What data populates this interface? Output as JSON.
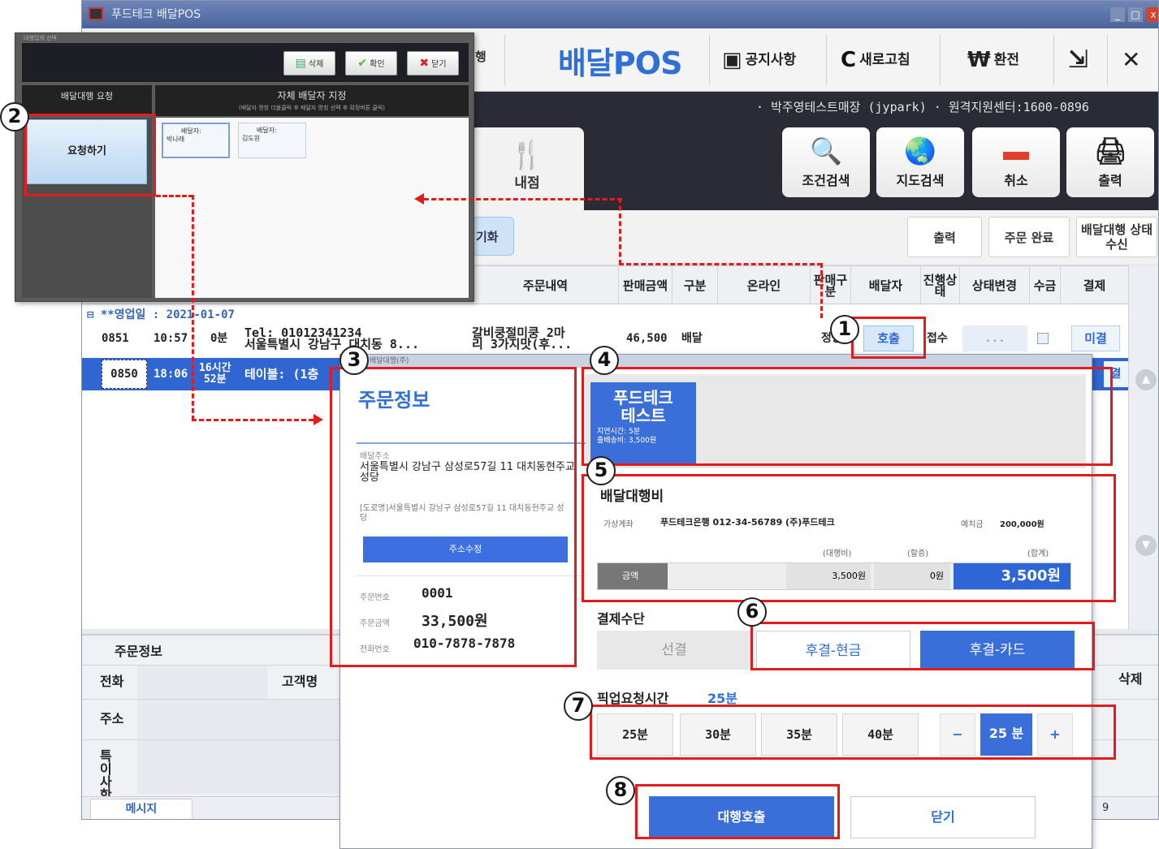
{
  "window": {
    "title": "푸드테크 배달POS"
  },
  "topbar": {
    "tail_fragment": "행",
    "brand_prefix": "배달",
    "brand_suffix": "POS",
    "notice": "공지사항",
    "refresh": "새로고침",
    "exchange": "환전"
  },
  "blackbar": {
    "store_info": "· 박주영테스트매장 (jypark)  · 원격지원센터:1600-0896",
    "store_tab": "내점",
    "buttons": [
      "조건검색",
      "지도검색",
      "취소",
      "출력"
    ]
  },
  "actionbar": {
    "light_fragment": "기화",
    "print": "출력",
    "complete": "주문 완료",
    "agency_status": "배달대행 상태 수신"
  },
  "grid": {
    "headers": [
      "주문내역",
      "판매금액",
      "구분",
      "온라인",
      "판매구분",
      "배달자",
      "진행상태",
      "상태변경",
      "수금",
      "결제"
    ],
    "group": "⊟ **영업일 : 2021-01-07",
    "rows": [
      {
        "no": "0851",
        "time": "10:57",
        "elapsed": "0분",
        "info1": "Tel: 01012341234",
        "info2": "서울특별시 강남구 대치동 8...",
        "items1": "갈비쿵절미쿵 2마",
        "items2": "리 3가지맛(후...",
        "amount": "46,500",
        "type": "배달",
        "sale": "정상",
        "rider": "호출",
        "status": "접수",
        "change": "...",
        "pay": "미결"
      },
      {
        "no": "0850",
        "time": "18:06",
        "elapsed1": "16시간",
        "elapsed2": "52분",
        "info": "테이블: (1층",
        "pay": "결"
      }
    ]
  },
  "bottom": {
    "title": "주문정보",
    "phone": "전화",
    "customer": "고객명",
    "address": "주소",
    "notes": "특이 사항",
    "delete": "삭제",
    "message": "메시지",
    "status_tail": "9"
  },
  "agency_popup": {
    "caption": "대행업체 선택",
    "buttons": [
      "삭제",
      "확인",
      "닫기"
    ],
    "left_head": "배달대행 요청",
    "right_head": "자체 배달자 지정",
    "right_sub": "(배달자 명칭 더블클릭 후 배달자 명칭 선택 후 확정버튼 클릭)",
    "request": "요청하기",
    "riders": [
      {
        "l1": "배달자:",
        "l2": "박나래"
      },
      {
        "l1": "배달자:",
        "l2": "김도원"
      }
    ]
  },
  "order_dialog": {
    "caption": "배달대행(주)",
    "title": "주문정보",
    "addr_label": "배달주소",
    "addr_main": "서울특별시 강남구 삼성로57길 11 대치동현주교 성당",
    "addr_road": "[도로명]서울특별시 강남구 삼성로57길 11 대치동현주교 성당",
    "addr_fix": "주소수정",
    "order_no_label": "주문번호",
    "order_no": "0001",
    "amount_label": "주문금액",
    "amount": "33,500원",
    "phone_label": "전화번호",
    "phone": "010-7878-7878",
    "agency": {
      "name1": "푸드테크",
      "name2": "테스트",
      "delay": "지연시간: 5분",
      "fee": "출배송비: 3,500원"
    },
    "fee_title": "배달대행비",
    "account_label": "가상계좌",
    "account": "푸드테크은행 012-34-56789 (주)푸드테크",
    "prepay_label": "예치금",
    "prepay": "200,000원",
    "col_agency": "(대행비)",
    "col_extra": "(할증)",
    "col_total": "(합계)",
    "amount_row": "금액",
    "agency_fee": "3,500원",
    "extra_fee": "0원",
    "total_fee": "3,500원",
    "pay_label": "결제수단",
    "pay_options": [
      "선결",
      "후결-현금",
      "후결-카드"
    ],
    "pickup_label": "픽업요청시간",
    "pickup_value": "25분",
    "time_options": [
      "25분",
      "30분",
      "35분",
      "40분"
    ],
    "stepper": {
      "minus": "−",
      "value": "25 분",
      "plus": "+"
    },
    "call": "대행호출",
    "close": "닫기"
  },
  "annotations": [
    "1",
    "2",
    "3",
    "4",
    "5",
    "6",
    "7",
    "8"
  ],
  "colors": {
    "accent": "#2f6fd6",
    "annotation": "#e31b1b",
    "dark_bar": "#2a2b34"
  }
}
